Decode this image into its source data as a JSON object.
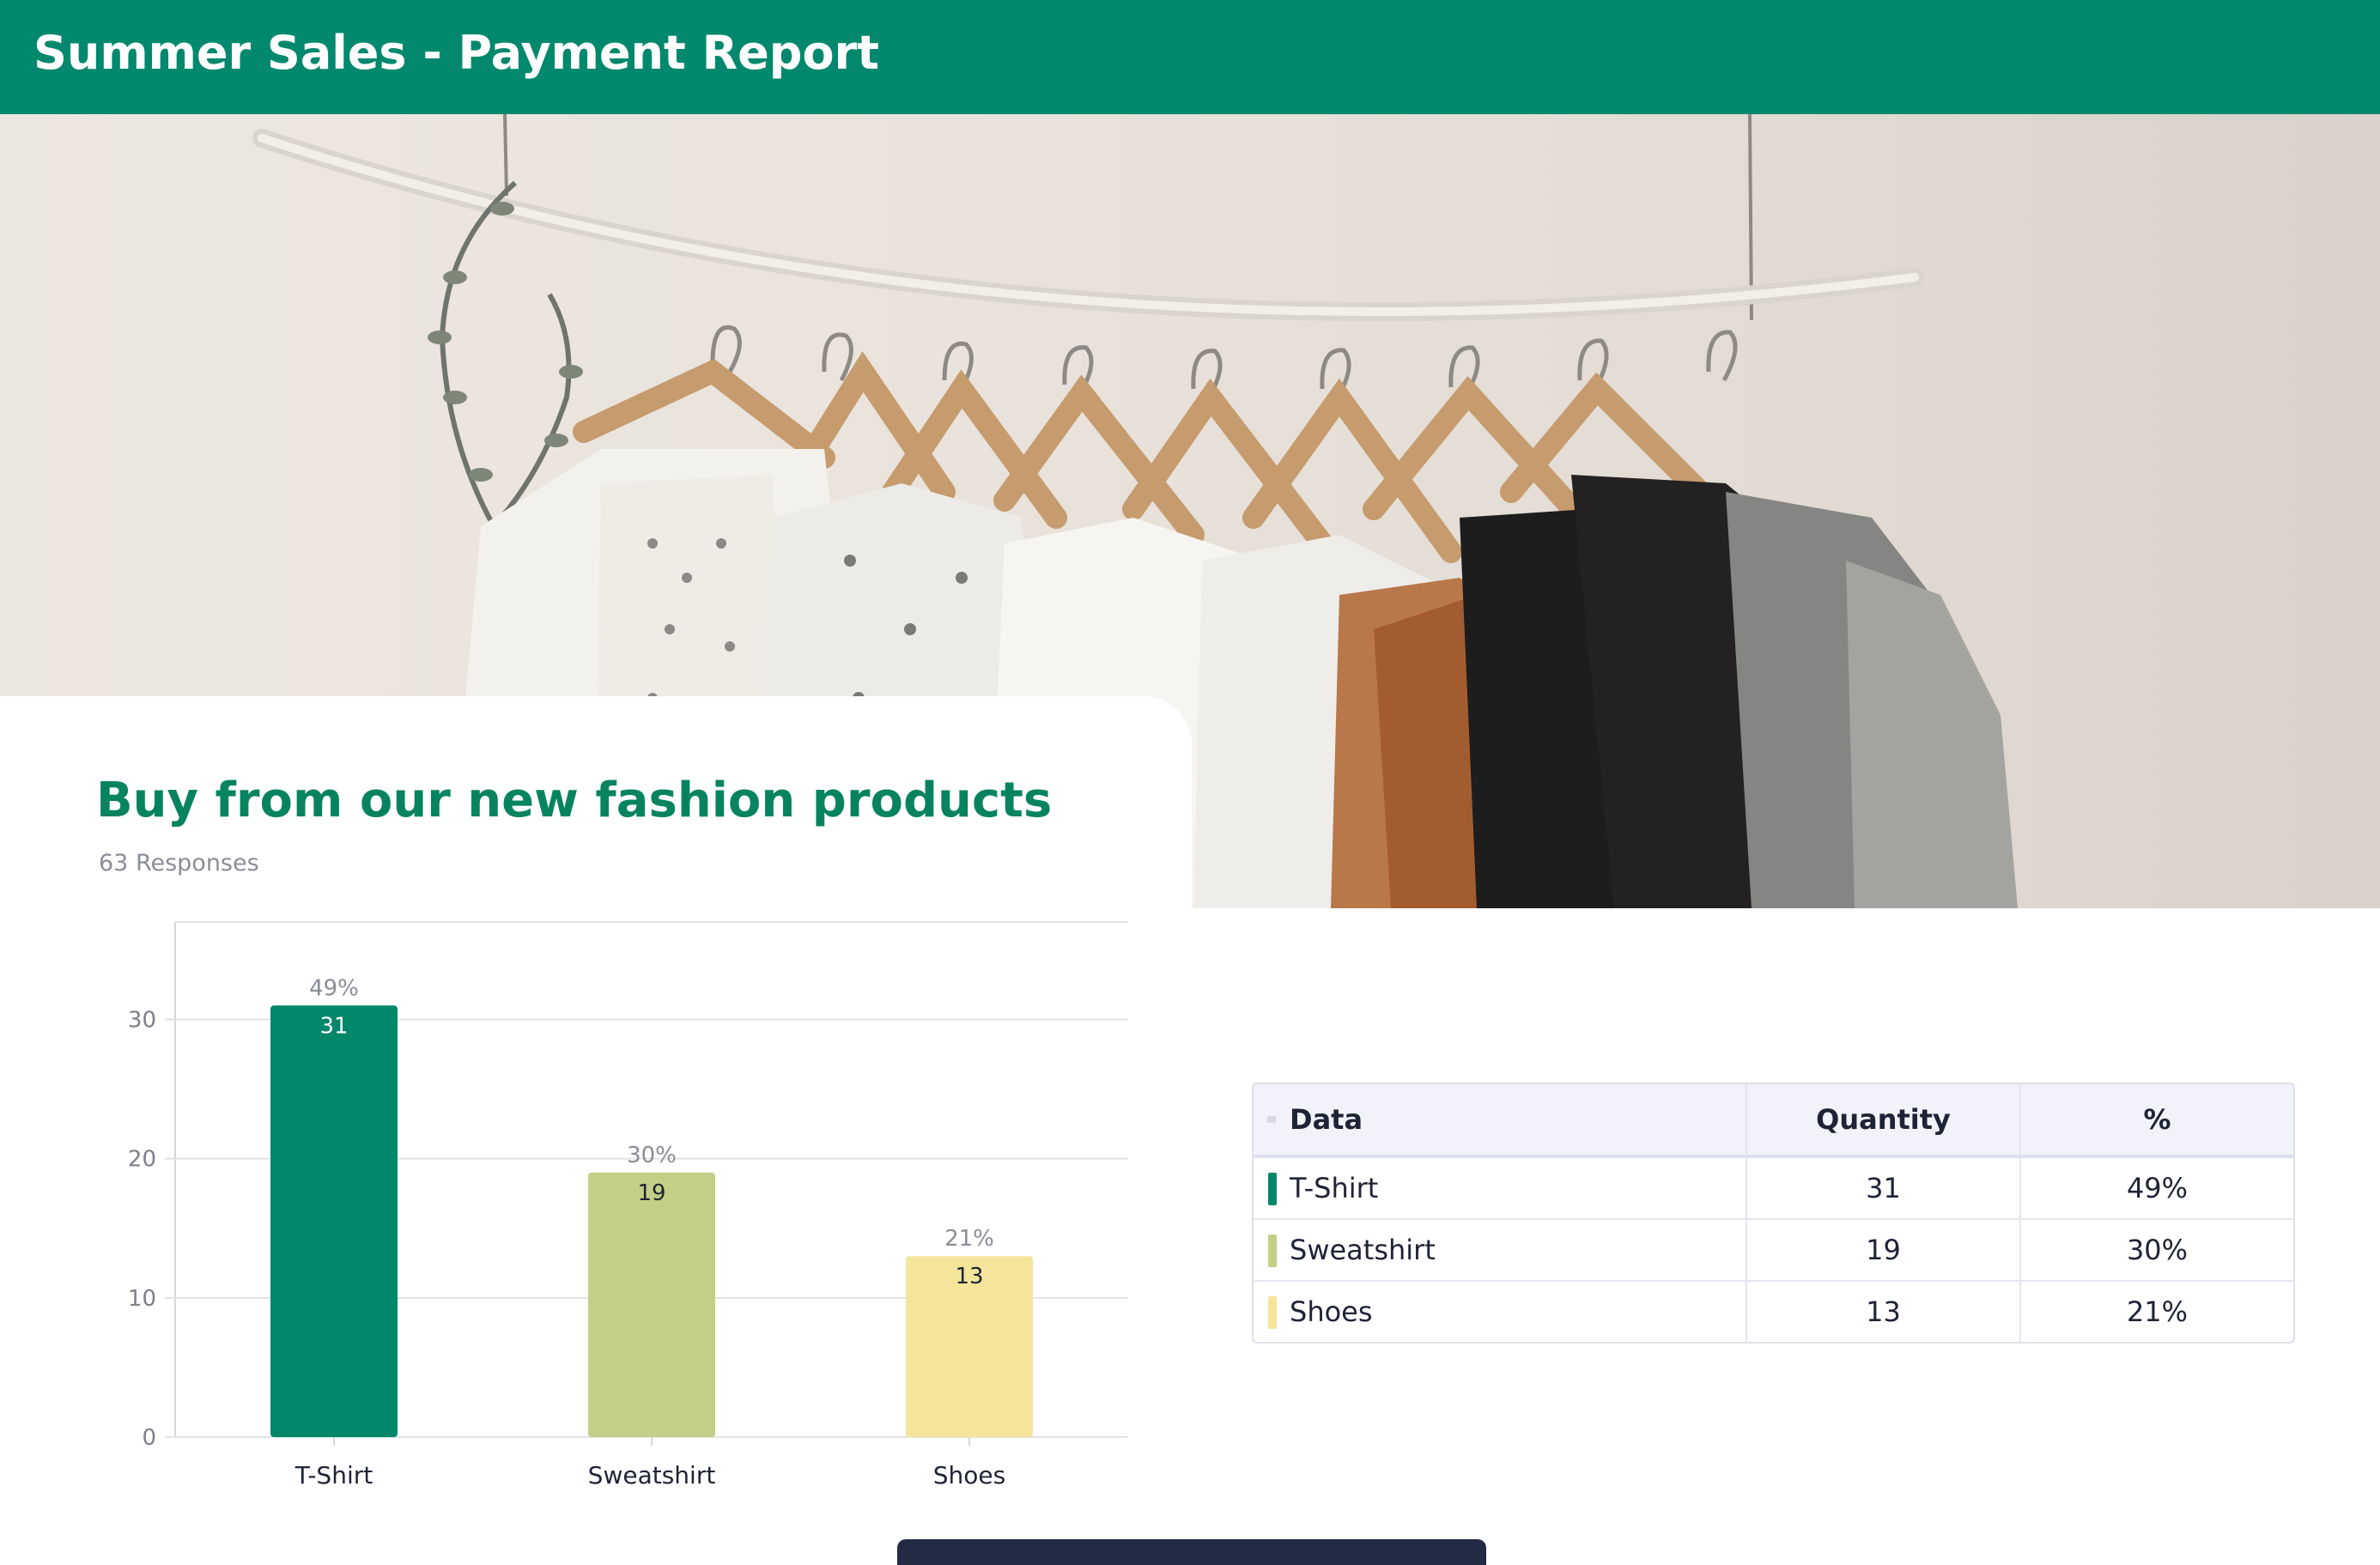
{
  "header": {
    "title": "Summer Sales - Payment Report",
    "color": "#02896d"
  },
  "hero": {
    "alt": "clothes rack photo",
    "icon": "clothing-rack-illustration"
  },
  "report": {
    "title": "Buy from our new fashion products",
    "responses": "63 Responses",
    "title_color": "#07845f"
  },
  "chart_data": {
    "type": "bar",
    "categories": [
      "T-Shirt",
      "Sweatshirt",
      "Shoes"
    ],
    "values": [
      31,
      19,
      13
    ],
    "percent_labels": [
      "49%",
      "30%",
      "21%"
    ],
    "colors": [
      "#02876b",
      "#c3cf86",
      "#f4e59b"
    ],
    "value_label_colors": [
      "#ffffff",
      "#1f2336",
      "#1f2336"
    ],
    "yticks": [
      0,
      10,
      20,
      30
    ],
    "ylim": [
      0,
      37
    ],
    "grid": true
  },
  "table": {
    "headers": [
      "Data",
      "Quantity",
      "%"
    ],
    "rows": [
      {
        "label": "T-Shirt",
        "quantity": "31",
        "percent": "49%",
        "color": "#02876b"
      },
      {
        "label": "Sweatshirt",
        "quantity": "19",
        "percent": "30%",
        "color": "#c3cf86"
      },
      {
        "label": "Shoes",
        "quantity": "13",
        "percent": "21%",
        "color": "#f4e59b"
      }
    ]
  }
}
